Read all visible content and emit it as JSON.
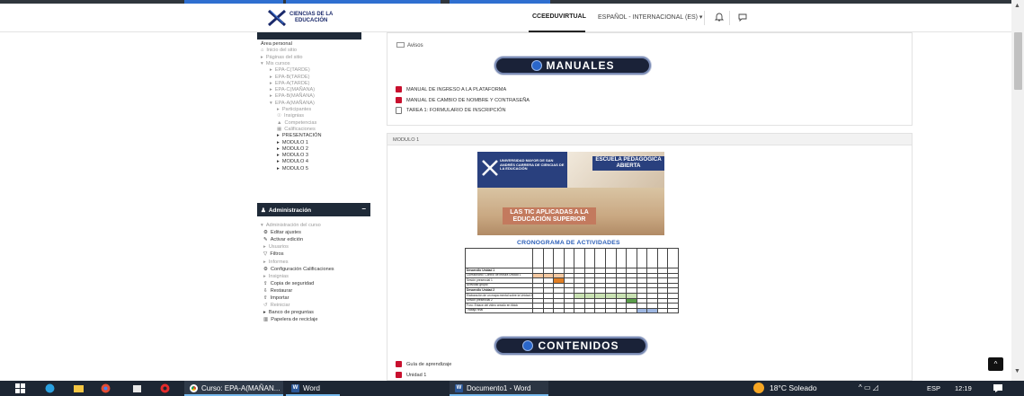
{
  "colors": {
    "navy": "#1f2a38",
    "accent_blue": "#2c5fb8",
    "pdf_red": "#c8102e",
    "taskbar": "#1d2633"
  },
  "header": {
    "logo_line1": "CIENCIAS DE LA",
    "logo_line2": "EDUCACIÓN",
    "nav_ccee": "CCEEDUVIRTUAL",
    "nav_lang": "ESPAÑOL - INTERNACIONAL (ES) ▾",
    "icons": [
      "bell-icon",
      "chat-icon"
    ]
  },
  "sidebar": {
    "nav_items": [
      {
        "label": "Área personal",
        "style": "dark",
        "icon": ""
      },
      {
        "label": "Inicio del sitio",
        "style": "muted",
        "icon": "⌂"
      },
      {
        "label": "Páginas del sitio",
        "style": "muted",
        "icon": "▸"
      },
      {
        "label": "Mis cursos",
        "style": "muted",
        "icon": "▾"
      },
      {
        "label": "EPA-C(TARDE)",
        "style": "muted",
        "icon": "▸"
      },
      {
        "label": "EPA-B(TARDE)",
        "style": "muted",
        "icon": "▸"
      },
      {
        "label": "EPA-A(TARDE)",
        "style": "muted",
        "icon": "▸"
      },
      {
        "label": "EPA-C(MAÑANA)",
        "style": "muted",
        "icon": "▸"
      },
      {
        "label": "EPA-B(MAÑANA)",
        "style": "muted",
        "icon": "▸"
      },
      {
        "label": "EPA-A(MAÑANA)",
        "style": "muted",
        "icon": "▾"
      },
      {
        "label": "Participantes",
        "style": "muted",
        "icon": "▸"
      },
      {
        "label": "Insignias",
        "style": "muted",
        "icon": "☉"
      },
      {
        "label": "Competencias",
        "style": "muted",
        "icon": "▲"
      },
      {
        "label": "Calificaciones",
        "style": "muted",
        "icon": "▦"
      },
      {
        "label": "PRESENTACIÓN",
        "style": "dark",
        "icon": "▸"
      },
      {
        "label": "MODULO 1",
        "style": "dark",
        "icon": "▸"
      },
      {
        "label": "MODULO 2",
        "style": "dark",
        "icon": "▸"
      },
      {
        "label": "MODULO 3",
        "style": "dark",
        "icon": "▸"
      },
      {
        "label": "MODULO 4",
        "style": "dark",
        "icon": "▸"
      },
      {
        "label": "MODULO 5",
        "style": "dark",
        "icon": "▸"
      }
    ],
    "admin_title": "Administración",
    "admin_collapse": "–",
    "admin_items": [
      {
        "label": "Administración del curso",
        "style": "muted",
        "icon": "▾"
      },
      {
        "label": "Editar ajustes",
        "style": "dark",
        "icon": "⚙"
      },
      {
        "label": "Activar edición",
        "style": "dark",
        "icon": "✎"
      },
      {
        "label": "Usuarios",
        "style": "muted",
        "icon": "▸"
      },
      {
        "label": "Filtros",
        "style": "dark",
        "icon": "▽"
      },
      {
        "label": "Informes",
        "style": "muted",
        "icon": "▸"
      },
      {
        "label": "Configuración Calificaciones",
        "style": "dark",
        "icon": "⚙"
      },
      {
        "label": "Insignias",
        "style": "muted",
        "icon": "▸"
      },
      {
        "label": "Copia de seguridad",
        "style": "dark",
        "icon": "⇪"
      },
      {
        "label": "Restaurar",
        "style": "dark",
        "icon": "⇩"
      },
      {
        "label": "Importar",
        "style": "dark",
        "icon": "⇧"
      },
      {
        "label": "Reiniciar",
        "style": "muted",
        "icon": "↺"
      },
      {
        "label": "Banco de preguntas",
        "style": "dark",
        "icon": "▸"
      },
      {
        "label": "Papelera de reciclaje",
        "style": "dark",
        "icon": "▥"
      }
    ]
  },
  "main": {
    "avisos": "Avisos",
    "banner_manuales": "MANUALES",
    "resources": [
      {
        "label": "MANUAL DE INGRESO A LA PLATAFORMA",
        "icon": "pdf-icon"
      },
      {
        "label": "MANUAL DE CAMBIO DE NOMBRE Y CONTRASEÑA",
        "icon": "pdf-icon"
      },
      {
        "label": "TAREA 1: FORMULARIO DE INSCRIPCIÓN",
        "icon": "form-icon"
      }
    ],
    "module1_title": "MODULO 1",
    "course_image": {
      "univ": "UNIVERSIDAD MAYOR DE SAN ANDRÉS CARRERA DE CIENCIAS DE LA EDUCACIÓN",
      "escuela": "ESCUELA PEDAGÓGICA ABIERTA",
      "title": "LAS TIC APLICADAS A LA EDUCACIÓN SUPERIOR"
    },
    "cronograma_title": "CRONOGRAMA DE ACTIVIDADES",
    "cronograma_rows": [
      {
        "label": "Desarrollo Unidad 1",
        "bold": true,
        "fills": []
      },
      {
        "label": "Cuestionario: Control de lectura Unidad 1",
        "bold": false,
        "fills": [
          [
            1,
            "c-or"
          ],
          [
            2,
            "c-or"
          ],
          [
            3,
            "c-or"
          ]
        ]
      },
      {
        "label": "Sesión presencial 1",
        "bold": false,
        "fills": [
          [
            3,
            "c-or2"
          ]
        ]
      },
      {
        "label": "Actividad grupal",
        "bold": false,
        "fills": []
      },
      {
        "label": "Desarrollo Unidad 2",
        "bold": true,
        "fills": []
      },
      {
        "label": "Elaboración de un mapa mental sobre la Unidad 2",
        "bold": false,
        "fills": [
          [
            5,
            "c-gr"
          ],
          [
            6,
            "c-gr"
          ],
          [
            7,
            "c-gr"
          ],
          [
            8,
            "c-gr"
          ],
          [
            9,
            "c-gr"
          ],
          [
            10,
            "c-gr"
          ]
        ]
      },
      {
        "label": "Sesión presencial 2",
        "bold": false,
        "fills": [
          [
            10,
            "c-gr2"
          ]
        ]
      },
      {
        "label": "Foro: Enlace del video creado en tiktok",
        "bold": false,
        "fills": []
      },
      {
        "label": "Trabajo final",
        "bold": false,
        "fills": [
          [
            11,
            "c-bl"
          ],
          [
            12,
            "c-bl"
          ]
        ]
      }
    ],
    "banner_contenidos": "CONTENIDOS",
    "contenidos": [
      {
        "label": "Guía de aprendizaje",
        "icon": "pdf-icon"
      },
      {
        "label": "Unidad 1",
        "icon": "pdf-icon"
      }
    ]
  },
  "fab_label": "^",
  "taskbar": {
    "task1": "Curso: EPA-A(MAÑAN...",
    "task2": "Word",
    "task3": "Documento1 - Word",
    "weather": "18°C Soleado",
    "tray": "^  ▭  ◿",
    "lang": "ESP",
    "time": "12:19"
  }
}
